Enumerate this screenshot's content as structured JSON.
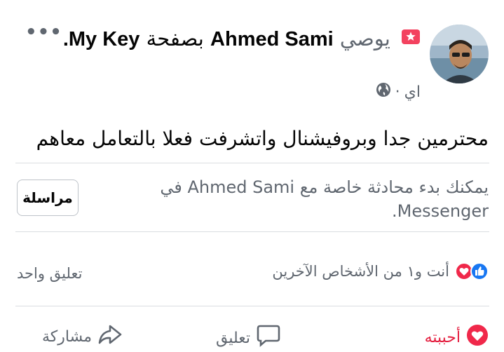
{
  "header": {
    "author": "Ahmed Sami",
    "recommends": "يوصي",
    "page_prefix": "بصفحة",
    "page_name": "My Key",
    "period": ".",
    "timestamp": "اي",
    "separator": "·",
    "more_icon": "more-horizontal-icon",
    "privacy_icon": "globe-icon",
    "recommend_icon": "recommendation-star-icon"
  },
  "post": {
    "text": "محترمين جدا وبروفيشنال واتشرفت فعلا بالتعامل معاهم"
  },
  "messenger": {
    "prompt": "يمكنك بدء محادثة خاصة مع Ahmed Sami في Messenger.",
    "button_label": "مراسلة"
  },
  "reactions": {
    "summary": "أنت و١ من الأشخاص الآخرين",
    "comment_count": "تعليق واحد",
    "icons": [
      "like-icon",
      "love-icon"
    ]
  },
  "actions": {
    "love_label": "أحببته",
    "comment_label": "تعليق",
    "share_label": "مشاركة"
  },
  "colors": {
    "love": "#e41e3f",
    "like": "#1877f2",
    "recommend": "#f3425f",
    "secondary_text": "#606770"
  }
}
